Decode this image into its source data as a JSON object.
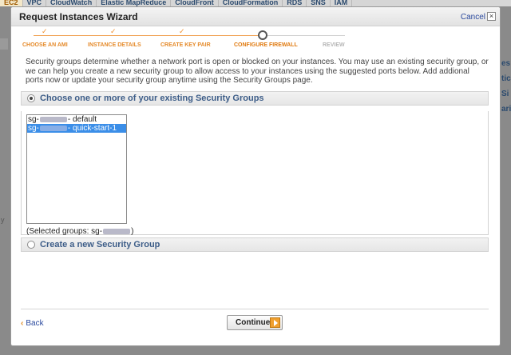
{
  "console": {
    "tabs": [
      "EC2",
      "VPC",
      "CloudWatch",
      "Elastic MapReduce",
      "CloudFront",
      "CloudFormation",
      "RDS",
      "SNS",
      "IAM"
    ],
    "right_fragments": [
      "es",
      "tic",
      "Si",
      "ari"
    ],
    "left_fragment": "y"
  },
  "dialog": {
    "title": "Request Instances Wizard",
    "cancel_label": "Cancel",
    "close_glyph": "×"
  },
  "steps": [
    {
      "label": "CHOOSE AN AMI",
      "state": "done"
    },
    {
      "label": "INSTANCE DETAILS",
      "state": "done"
    },
    {
      "label": "CREATE KEY PAIR",
      "state": "done"
    },
    {
      "label": "CONFIGURE FIREWALL",
      "state": "current"
    },
    {
      "label": "REVIEW",
      "state": "todo"
    }
  ],
  "step_tick_glyph": "✓",
  "intro_text": "Security groups determine whether a network port is open or blocked on your instances. You may use an existing security group, or we can help you create a new security group to allow access to your instances using the suggested ports below. Add addional ports now or update your security group anytime using the Security Groups page.",
  "existing_option": {
    "label": "Choose one or more of your existing Security Groups",
    "selected": true
  },
  "security_groups": [
    {
      "prefix": "sg-",
      "name": "- default",
      "selected": false
    },
    {
      "prefix": "sg-",
      "name": "- quick-start-1",
      "selected": true
    }
  ],
  "selected_groups_prefix": "(Selected groups:  sg-",
  "selected_groups_suffix": ")",
  "new_option": {
    "label": "Create a new Security Group",
    "selected": false
  },
  "footer": {
    "back_chevron": "‹",
    "back_label": "Back",
    "continue_label": "Continue"
  },
  "colors": {
    "accent_orange": "#e58a2a",
    "link_blue": "#2b4a9e",
    "section_title_blue": "#3d5d88",
    "selection_blue": "#3b8ee8"
  }
}
